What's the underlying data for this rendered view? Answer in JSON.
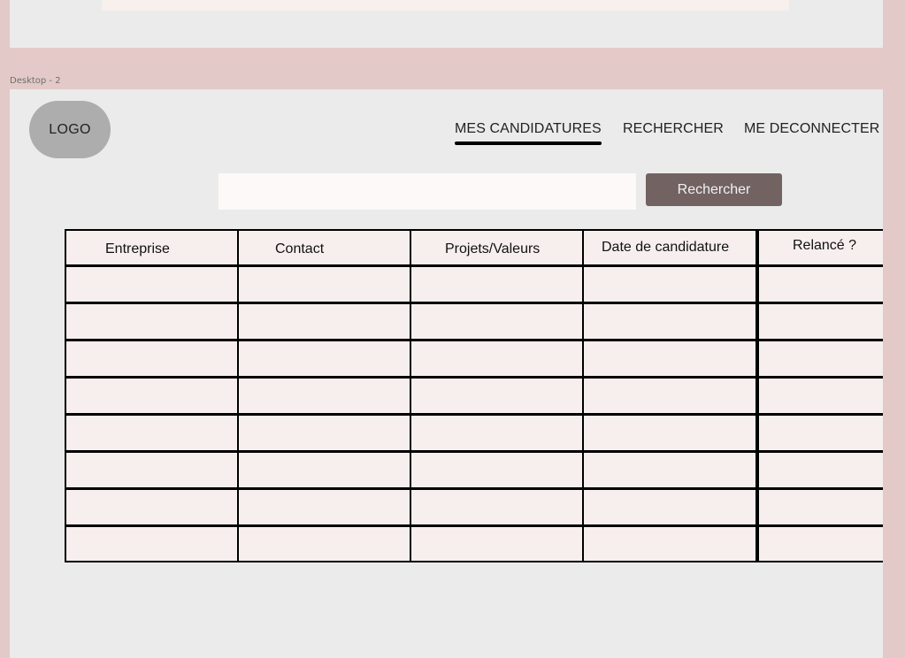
{
  "canvas": {
    "frame_label": "Desktop - 2"
  },
  "header": {
    "logo_text": "LOGO",
    "nav": [
      {
        "label": "MES CANDIDATURES",
        "active": true
      },
      {
        "label": "RECHERCHER",
        "active": false
      },
      {
        "label": "ME DECONNECTER",
        "active": false
      }
    ]
  },
  "search": {
    "input_value": "",
    "button_label": "Rechercher"
  },
  "table": {
    "columns": [
      "Entreprise",
      "Contact",
      "Projets/Valeurs",
      "Date de candidature",
      "Relancé ?"
    ],
    "rows": [
      [
        "",
        "",
        "",
        "",
        ""
      ],
      [
        "",
        "",
        "",
        "",
        ""
      ],
      [
        "",
        "",
        "",
        "",
        ""
      ],
      [
        "",
        "",
        "",
        "",
        ""
      ],
      [
        "",
        "",
        "",
        "",
        ""
      ],
      [
        "",
        "",
        "",
        "",
        ""
      ],
      [
        "",
        "",
        "",
        "",
        ""
      ],
      [
        "",
        "",
        "",
        "",
        ""
      ]
    ]
  },
  "colors": {
    "canvas_bg": "#e4c9c9",
    "frame_bg": "#ebebeb",
    "cell_bg": "#f7efed",
    "button_bg": "#726262",
    "logo_bg": "#adadad"
  }
}
